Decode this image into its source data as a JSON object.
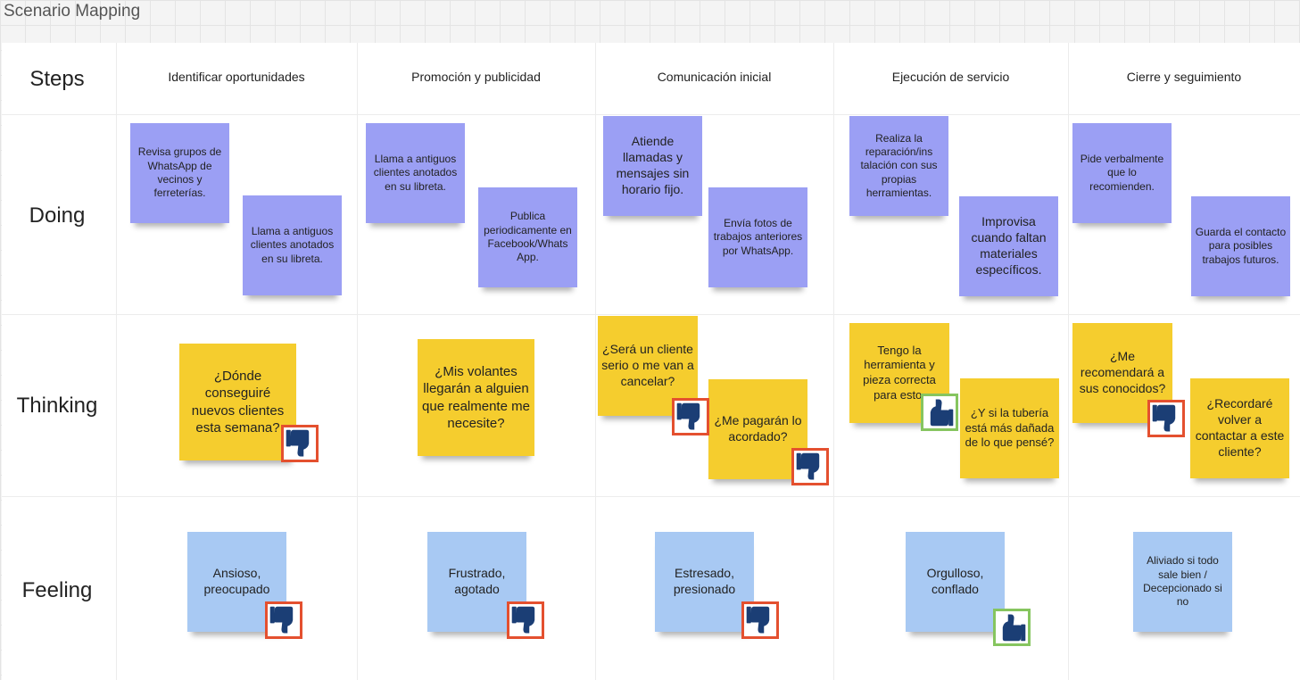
{
  "board": {
    "title": "Scenario Mapping"
  },
  "rows": {
    "steps": "Steps",
    "doing": "Doing",
    "thinking": "Thinking",
    "feeling": "Feeling"
  },
  "columns": [
    "Identificar oportunidades",
    "Promoción y publicidad",
    "Comunicación inicial",
    "Ejecución de servicio",
    "Cierre y seguimiento"
  ],
  "doing": [
    [
      "Revisa grupos de WhatsApp de vecinos y ferreterías.",
      "Llama a antiguos clientes anotados en su libreta."
    ],
    [
      "Llama a antiguos clientes anotados en su libreta.",
      "Publica periodicamente en Facebook/Whats App."
    ],
    [
      "Atiende llamadas y mensajes sin horario fijo.",
      "Envía fotos de trabajos anteriores por WhatsApp."
    ],
    [
      "Realiza la reparación/ins talación con sus propias herramientas.",
      "Improvisa cuando faltan materiales específicos."
    ],
    [
      "Pide verbalmente que lo recomienden.",
      "Guarda el contacto para posibles trabajos futuros."
    ]
  ],
  "thinking": [
    [
      "¿Dónde conseguiré nuevos clientes esta semana?"
    ],
    [
      "¿Mis volantes llegarán a alguien que realmente me necesite?"
    ],
    [
      "¿Será un cliente serio o me van a cancelar?",
      "¿Me pagarán lo acordado?"
    ],
    [
      "Tengo la herramienta y pieza correcta para esto.",
      "¿Y si la tubería está más dañada de lo que pensé?"
    ],
    [
      "¿Me recomendará a sus conocidos?",
      "¿Recordaré volver a contactar a este cliente?"
    ]
  ],
  "feeling": [
    "Ansioso, preocupado",
    "Frustrado, agotado",
    "Estresado, presionado",
    "Orgulloso, conflado",
    "Aliviado si todo sale bien / Decepcionado si no"
  ],
  "reactions": {
    "thumbs_down": "thumbs-down-icon",
    "thumbs_up": "thumbs-up-icon",
    "negative_border": "#e4502f",
    "positive_border": "#86c55f"
  },
  "colors": {
    "doing_sticky": "#9b9ff4",
    "thinking_sticky": "#f5cd2e",
    "feeling_sticky": "#a8c9f3",
    "thumb": "#1b3e75"
  }
}
